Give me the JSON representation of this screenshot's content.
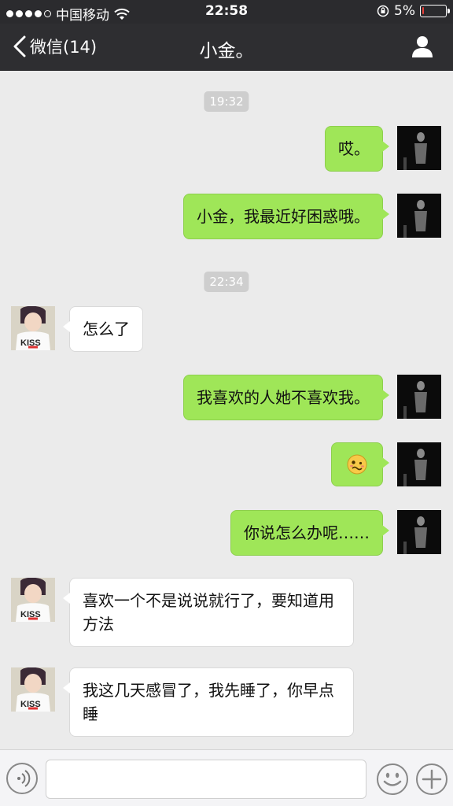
{
  "status_bar": {
    "carrier": "中国移动",
    "time": "22:58",
    "battery": "5%",
    "battery_level": 0.05,
    "signal_bars_filled": 4,
    "battery_color": "#e8413a"
  },
  "nav": {
    "back_label": "微信(14)",
    "title": "小金。"
  },
  "messages": {
    "ts1": "19:32",
    "m1": "哎。",
    "m2": "小金，我最近好困惑哦。",
    "ts2": "22:34",
    "m3": "怎么了",
    "m4": "我喜欢的人她不喜欢我。",
    "m5_emoji": "🥴",
    "m6": "你说怎么办呢……",
    "m7": "喜欢一个不是说说就行了，要知道用方法",
    "m8": "我这几天感冒了，我先睡了，你早点睡"
  },
  "colors": {
    "sent_bubble": "#9fe658",
    "received_bubble": "#ffffff",
    "chat_background": "#ebebeb",
    "nav_background": "#2e2e31"
  },
  "icons": {
    "back": "chevron-left-icon",
    "profile": "person-icon",
    "voice": "voice-icon",
    "emoji": "smiley-icon",
    "plus": "plus-icon"
  }
}
